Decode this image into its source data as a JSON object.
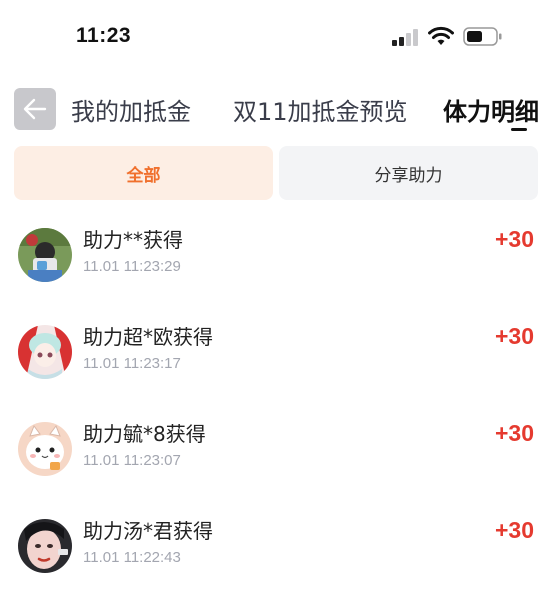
{
  "status_bar": {
    "time": "11:23"
  },
  "header": {
    "back_icon": "arrow-left-icon",
    "tabs": [
      {
        "label": "我的加抵金"
      },
      {
        "label": "双11加抵金预览"
      },
      {
        "label": "体力明细",
        "active": true
      }
    ]
  },
  "filters": {
    "all_label": "全部",
    "share_label": "分享助力",
    "active": "全部"
  },
  "colors": {
    "accent": "#f0702d",
    "accent_bg": "#fdeee4",
    "points": "#e53a2f",
    "muted": "#a3a6b0"
  },
  "records": [
    {
      "title": "助力**获得",
      "time": "11.01 11:23:29",
      "points": "+30",
      "avatar": "avatar-photo-camera"
    },
    {
      "title": "助力超*欧获得",
      "time": "11.01 11:23:17",
      "points": "+30",
      "avatar": "avatar-anime-girl"
    },
    {
      "title": "助力毓*8获得",
      "time": "11.01 11:23:07",
      "points": "+30",
      "avatar": "avatar-white-cat"
    },
    {
      "title": "助力汤*君获得",
      "time": "11.01 11:22:43",
      "points": "+30",
      "avatar": "avatar-portrait"
    }
  ]
}
